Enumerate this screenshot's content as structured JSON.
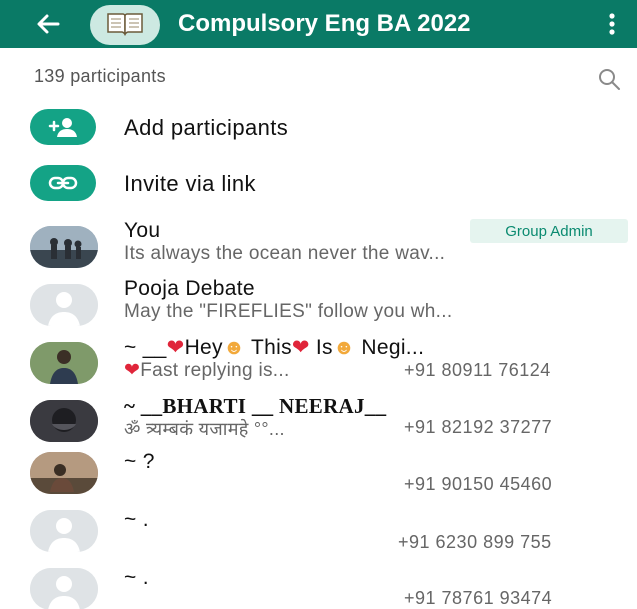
{
  "header": {
    "title": "Compulsory Eng BA 2022",
    "back_icon": "arrow-left-icon",
    "group_icon": "book-icon",
    "menu_icon": "more-vert-icon",
    "bg_color": "#0a7a66"
  },
  "participants": {
    "count_label": "139 participants",
    "search_icon": "search-icon"
  },
  "actions": [
    {
      "label": "Add participants",
      "icon": "add-person-icon"
    },
    {
      "label": "Invite via link",
      "icon": "link-icon"
    }
  ],
  "members": [
    {
      "name": "You",
      "about": "Its always the ocean never the wav...",
      "badge": "Group Admin",
      "phone": ""
    },
    {
      "name": "Pooja Debate",
      "about": "May the \"FIREFLIES\" follow you wh...",
      "phone": ""
    },
    {
      "name_parts": [
        "~ __",
        "Hey",
        "This",
        "Is",
        "Negi..."
      ],
      "about_parts": [
        "Fast replying is..."
      ],
      "phone": "+91 80911 76124"
    },
    {
      "name": "~ __BHARTI __ NEERAJ__",
      "about": "ॐ त्र्यम्बकं यजामहे °°...",
      "phone": "+91 82192 37277"
    },
    {
      "name": "~ ?",
      "about": "",
      "phone": "+91 90150 45460"
    },
    {
      "name": "~ .",
      "about": "",
      "phone": "+91 6230 899 755"
    },
    {
      "name": "~ .",
      "about": "",
      "phone": "+91 78761 93474"
    }
  ],
  "colors": {
    "accent": "#14a386",
    "badge_bg": "#e5f4ef",
    "badge_text": "#0a8a70"
  }
}
